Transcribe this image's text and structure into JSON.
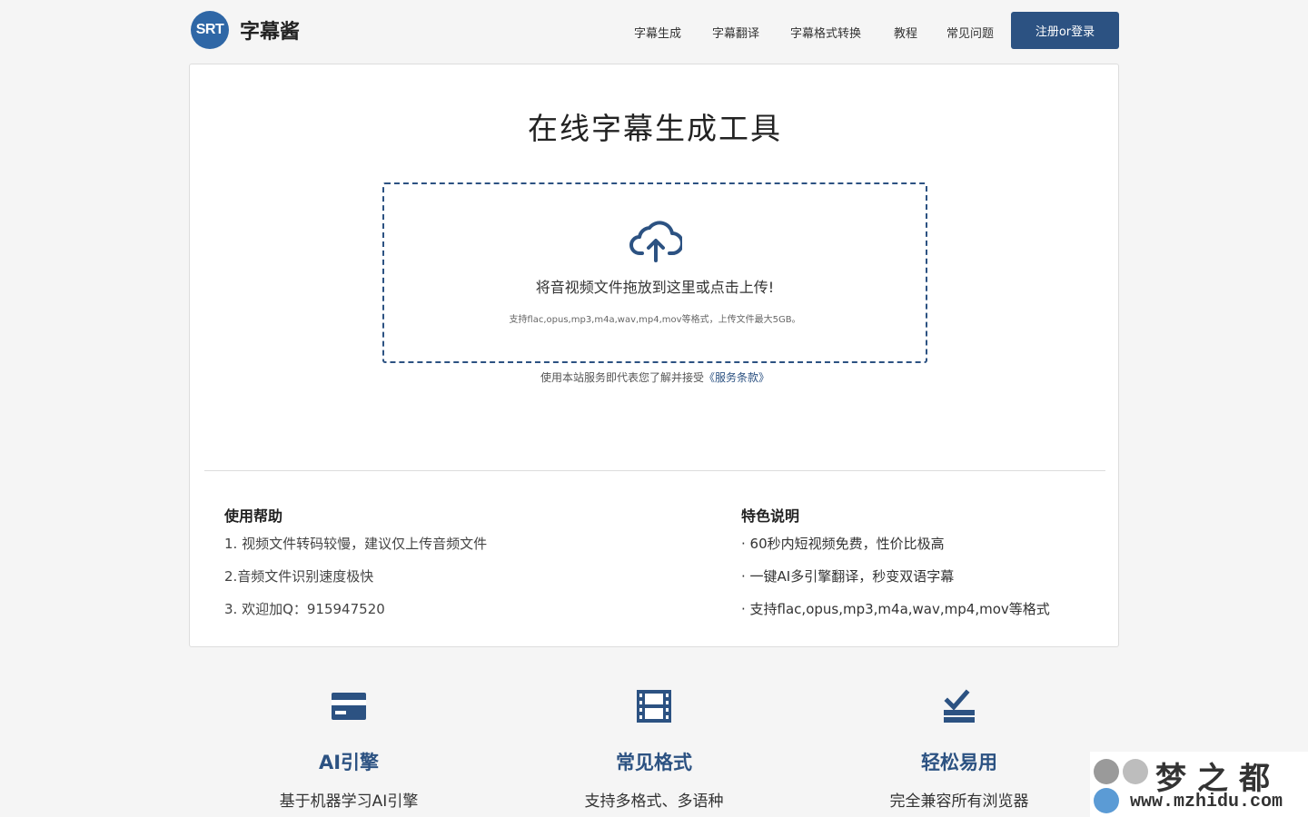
{
  "header": {
    "logo_badge": "SRT",
    "logo_name": "字幕酱",
    "nav": [
      {
        "label": "字幕生成"
      },
      {
        "label": "字幕翻译"
      },
      {
        "label": "字幕格式转换"
      },
      {
        "label": "教程"
      },
      {
        "label": "常见问题"
      }
    ],
    "login_label": "注册or登录"
  },
  "main": {
    "title": "在线字幕生成工具",
    "upload": {
      "icon": "cloud-upload-icon",
      "prompt": "将音视频文件拖放到这里或点击上传!",
      "hint": "支持flac,opus,mp3,m4a,wav,mp4,mov等格式，上传文件最大5GB。"
    },
    "terms_text": "使用本站服务即代表您了解并接受",
    "terms_link": "《服务条款》"
  },
  "help": {
    "title": "使用帮助",
    "items": [
      "1. 视频文件转码较慢，建议仅上传音频文件",
      "2.音频文件识别速度极快",
      "3. 欢迎加Q：915947520"
    ]
  },
  "features_info": {
    "title": "特色说明",
    "items": [
      "· 60秒内短视频免费，性价比极高",
      "· 一键AI多引擎翻译，秒变双语字幕",
      "· 支持flac,opus,mp3,m4a,wav,mp4,mov等格式"
    ]
  },
  "features": [
    {
      "icon": "credit-card-icon",
      "title": "AI引擎",
      "desc": "基于机器学习AI引擎"
    },
    {
      "icon": "film-icon",
      "title": "常见格式",
      "desc": "支持多格式、多语种"
    },
    {
      "icon": "check-tray-icon",
      "title": "轻松易用",
      "desc": "完全兼容所有浏览器"
    }
  ],
  "watermark": {
    "title": "梦之都",
    "url": "www.mzhidu.com"
  },
  "colors": {
    "accent": "#2c5282",
    "logo": "#2f67a6",
    "background": "#f5f5f5"
  }
}
